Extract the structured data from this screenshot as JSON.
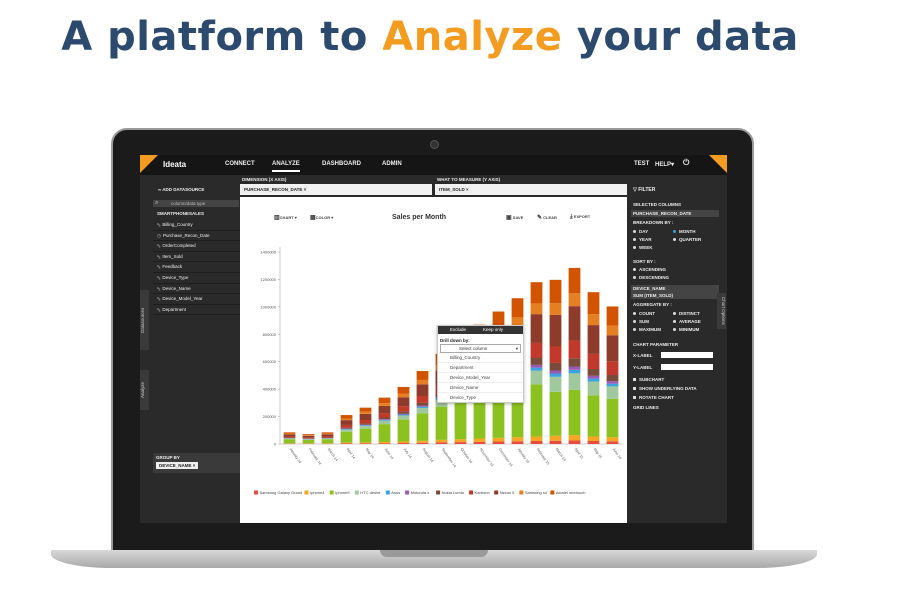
{
  "headline": {
    "part1": "A platform to ",
    "accent": "Analyze",
    "part2": " your data"
  },
  "colors": {
    "accent": "#f39c1f",
    "headline": "#2c4a6e"
  },
  "app": {
    "logo": "Ideata",
    "nav": [
      "CONNECT",
      "ANALYZE",
      "DASHBOARD",
      "ADMIN"
    ],
    "user": "TEST",
    "help": "HELP",
    "power_icon": "power-icon"
  },
  "left": {
    "add_datasource": "ADD DATASOURCE",
    "search_placeholder": "column/data type",
    "group_title": "SMARTPHONESALES",
    "columns": [
      "Billing_Country",
      "Purchase_Recon_Date",
      "OrderCompleted",
      "Item_Sold",
      "Feedback",
      "Device_Type",
      "Device_Name",
      "Device_Model_Year",
      "Department"
    ],
    "tab_datasources": "Datasources",
    "tab_analyze": "Analyze",
    "group_by": "GROUP BY",
    "group_by_chip": "DEVICE_NAME"
  },
  "dimension": {
    "x_label": "DIMENSION (X AXIS)",
    "x_chip": "PURCHASE_RECON_DATE",
    "y_label": "WHAT TO MEASURE (Y AXIS)",
    "y_chip": "ITEM_SOLD",
    "remove": "×"
  },
  "toolbar": {
    "chart": "CHART",
    "color": "COLOR",
    "save": "SAVE",
    "clear": "CLEAR",
    "export": "EXPORT"
  },
  "popup": {
    "exclude": "Exclude",
    "keep_only": "Keep only",
    "drill_label": "Drill down by:",
    "select_placeholder": "Select column",
    "options": [
      "Billing_Country",
      "Department",
      "Device_Model_Year",
      "Device_Name",
      "Device_Type"
    ]
  },
  "right": {
    "filter": "FILTER",
    "selected_columns": "SELECTED COLUMNS",
    "x_column": "PURCHASE_RECON_DATE",
    "breakdown_by": "BREAKDOWN BY :",
    "breakdown": [
      "DAY",
      "MONTH",
      "YEAR",
      "QUARTER",
      "WEEK"
    ],
    "sort_by": "SORT BY :",
    "sort": [
      "ASCENDING",
      "DESCENDING"
    ],
    "device_name": "DEVICE_NAME",
    "sum_item": "SUM (ITEM_SOLD)",
    "aggregate_by": "AGGREGATE BY :",
    "aggregate": [
      "COUNT",
      "DISTINCT",
      "SUM",
      "AVERAGE",
      "MAXIMUM",
      "MINIMUM"
    ],
    "chart_parameter": "CHART PARAMETER",
    "x_label": "X-LABEL",
    "y_label": "Y-LABEL",
    "subchart": "SUBCHART",
    "show_underlying": "SHOW UNDERLYING DATA",
    "rotate_chart": "ROTATE CHART",
    "grid_lines": "GRID LINES",
    "chart_options_tab": "Chart Options"
  },
  "chart_data": {
    "type": "bar",
    "stacked": true,
    "title": "Sales per Month",
    "ylim": [
      0,
      1400000
    ],
    "yticks": [
      0,
      200000,
      400000,
      600000,
      800000,
      1000000,
      1200000,
      1400000
    ],
    "categories": [
      "January 14",
      "February 14",
      "March 14",
      "April 14",
      "May 14",
      "June 14",
      "July 14",
      "August 14",
      "September 14",
      "October 14",
      "November 14",
      "December 14",
      "January 15",
      "February 15",
      "March 15",
      "April 15",
      "May 15",
      "June 15"
    ],
    "series": [
      {
        "name": "Samsung Galaxy Grand",
        "color": "#e74c3c",
        "values": [
          2000,
          2000,
          2000,
          4000,
          5000,
          6000,
          7000,
          9000,
          12000,
          14000,
          16000,
          18000,
          20000,
          22000,
          24000,
          26000,
          22000,
          20000
        ]
      },
      {
        "name": "Iphone4",
        "color": "#f5a623",
        "values": [
          3000,
          3000,
          3000,
          6000,
          7000,
          9000,
          11000,
          14000,
          18000,
          21000,
          24000,
          27000,
          30000,
          33000,
          36000,
          39000,
          33000,
          30000
        ]
      },
      {
        "name": "Iphone5",
        "color": "#8cc220",
        "values": [
          30000,
          25000,
          30000,
          80000,
          100000,
          130000,
          160000,
          200000,
          240000,
          280000,
          300000,
          320000,
          340000,
          380000,
          320000,
          330000,
          300000,
          280000
        ]
      },
      {
        "name": "HTC desire",
        "color": "#9fc99c",
        "values": [
          5000,
          4000,
          5000,
          15000,
          20000,
          25000,
          30000,
          40000,
          50000,
          60000,
          70000,
          80000,
          90000,
          100000,
          110000,
          120000,
          100000,
          90000
        ]
      },
      {
        "name": "Asus",
        "color": "#3ba3e0",
        "values": [
          2000,
          2000,
          2000,
          4000,
          5000,
          6000,
          7000,
          9000,
          12000,
          14000,
          16000,
          18000,
          20000,
          22000,
          24000,
          26000,
          22000,
          20000
        ]
      },
      {
        "name": "Motorola x",
        "color": "#9b59b6",
        "values": [
          2000,
          2000,
          2000,
          3000,
          4000,
          5000,
          6000,
          8000,
          10000,
          12000,
          14000,
          16000,
          18000,
          20000,
          22000,
          24000,
          20000,
          18000
        ]
      },
      {
        "name": "Nokia Lumia",
        "color": "#7a4b3a",
        "values": [
          3000,
          3000,
          3000,
          7000,
          9000,
          12000,
          15000,
          20000,
          25000,
          30000,
          35000,
          40000,
          45000,
          50000,
          55000,
          60000,
          50000,
          45000
        ]
      },
      {
        "name": "Karbonn",
        "color": "#c0392b",
        "values": [
          8000,
          7000,
          8000,
          20000,
          25000,
          30000,
          40000,
          50000,
          60000,
          70000,
          80000,
          90000,
          100000,
          110000,
          120000,
          130000,
          110000,
          100000
        ]
      },
      {
        "name": "Nexus 5",
        "color": "#8e3b2b",
        "values": [
          15000,
          12000,
          15000,
          35000,
          45000,
          55000,
          65000,
          85000,
          110000,
          130000,
          150000,
          170000,
          190000,
          210000,
          230000,
          250000,
          210000,
          190000
        ]
      },
      {
        "name": "Samsung s4",
        "color": "#e67e22",
        "values": [
          5000,
          4000,
          5000,
          12000,
          15000,
          20000,
          25000,
          32000,
          40000,
          48000,
          55000,
          62000,
          70000,
          78000,
          86000,
          94000,
          80000,
          70000
        ]
      },
      {
        "name": "Alcatel onetouch",
        "color": "#d35400",
        "values": [
          10000,
          8000,
          10000,
          25000,
          30000,
          40000,
          50000,
          65000,
          80000,
          95000,
          110000,
          125000,
          140000,
          155000,
          170000,
          185000,
          160000,
          140000
        ]
      }
    ],
    "legend_position": "bottom"
  }
}
